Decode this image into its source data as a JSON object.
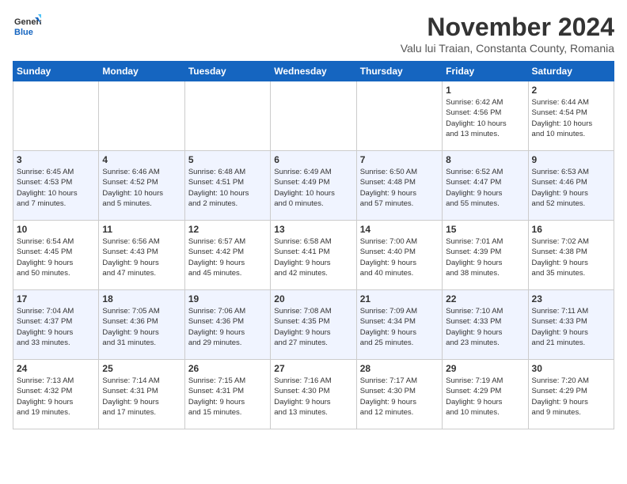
{
  "logo": {
    "line1": "General",
    "line2": "Blue"
  },
  "title": "November 2024",
  "subtitle": "Valu lui Traian, Constanta County, Romania",
  "weekdays": [
    "Sunday",
    "Monday",
    "Tuesday",
    "Wednesday",
    "Thursday",
    "Friday",
    "Saturday"
  ],
  "weeks": [
    [
      {
        "day": "",
        "info": ""
      },
      {
        "day": "",
        "info": ""
      },
      {
        "day": "",
        "info": ""
      },
      {
        "day": "",
        "info": ""
      },
      {
        "day": "",
        "info": ""
      },
      {
        "day": "1",
        "info": "Sunrise: 6:42 AM\nSunset: 4:56 PM\nDaylight: 10 hours\nand 13 minutes."
      },
      {
        "day": "2",
        "info": "Sunrise: 6:44 AM\nSunset: 4:54 PM\nDaylight: 10 hours\nand 10 minutes."
      }
    ],
    [
      {
        "day": "3",
        "info": "Sunrise: 6:45 AM\nSunset: 4:53 PM\nDaylight: 10 hours\nand 7 minutes."
      },
      {
        "day": "4",
        "info": "Sunrise: 6:46 AM\nSunset: 4:52 PM\nDaylight: 10 hours\nand 5 minutes."
      },
      {
        "day": "5",
        "info": "Sunrise: 6:48 AM\nSunset: 4:51 PM\nDaylight: 10 hours\nand 2 minutes."
      },
      {
        "day": "6",
        "info": "Sunrise: 6:49 AM\nSunset: 4:49 PM\nDaylight: 10 hours\nand 0 minutes."
      },
      {
        "day": "7",
        "info": "Sunrise: 6:50 AM\nSunset: 4:48 PM\nDaylight: 9 hours\nand 57 minutes."
      },
      {
        "day": "8",
        "info": "Sunrise: 6:52 AM\nSunset: 4:47 PM\nDaylight: 9 hours\nand 55 minutes."
      },
      {
        "day": "9",
        "info": "Sunrise: 6:53 AM\nSunset: 4:46 PM\nDaylight: 9 hours\nand 52 minutes."
      }
    ],
    [
      {
        "day": "10",
        "info": "Sunrise: 6:54 AM\nSunset: 4:45 PM\nDaylight: 9 hours\nand 50 minutes."
      },
      {
        "day": "11",
        "info": "Sunrise: 6:56 AM\nSunset: 4:43 PM\nDaylight: 9 hours\nand 47 minutes."
      },
      {
        "day": "12",
        "info": "Sunrise: 6:57 AM\nSunset: 4:42 PM\nDaylight: 9 hours\nand 45 minutes."
      },
      {
        "day": "13",
        "info": "Sunrise: 6:58 AM\nSunset: 4:41 PM\nDaylight: 9 hours\nand 42 minutes."
      },
      {
        "day": "14",
        "info": "Sunrise: 7:00 AM\nSunset: 4:40 PM\nDaylight: 9 hours\nand 40 minutes."
      },
      {
        "day": "15",
        "info": "Sunrise: 7:01 AM\nSunset: 4:39 PM\nDaylight: 9 hours\nand 38 minutes."
      },
      {
        "day": "16",
        "info": "Sunrise: 7:02 AM\nSunset: 4:38 PM\nDaylight: 9 hours\nand 35 minutes."
      }
    ],
    [
      {
        "day": "17",
        "info": "Sunrise: 7:04 AM\nSunset: 4:37 PM\nDaylight: 9 hours\nand 33 minutes."
      },
      {
        "day": "18",
        "info": "Sunrise: 7:05 AM\nSunset: 4:36 PM\nDaylight: 9 hours\nand 31 minutes."
      },
      {
        "day": "19",
        "info": "Sunrise: 7:06 AM\nSunset: 4:36 PM\nDaylight: 9 hours\nand 29 minutes."
      },
      {
        "day": "20",
        "info": "Sunrise: 7:08 AM\nSunset: 4:35 PM\nDaylight: 9 hours\nand 27 minutes."
      },
      {
        "day": "21",
        "info": "Sunrise: 7:09 AM\nSunset: 4:34 PM\nDaylight: 9 hours\nand 25 minutes."
      },
      {
        "day": "22",
        "info": "Sunrise: 7:10 AM\nSunset: 4:33 PM\nDaylight: 9 hours\nand 23 minutes."
      },
      {
        "day": "23",
        "info": "Sunrise: 7:11 AM\nSunset: 4:33 PM\nDaylight: 9 hours\nand 21 minutes."
      }
    ],
    [
      {
        "day": "24",
        "info": "Sunrise: 7:13 AM\nSunset: 4:32 PM\nDaylight: 9 hours\nand 19 minutes."
      },
      {
        "day": "25",
        "info": "Sunrise: 7:14 AM\nSunset: 4:31 PM\nDaylight: 9 hours\nand 17 minutes."
      },
      {
        "day": "26",
        "info": "Sunrise: 7:15 AM\nSunset: 4:31 PM\nDaylight: 9 hours\nand 15 minutes."
      },
      {
        "day": "27",
        "info": "Sunrise: 7:16 AM\nSunset: 4:30 PM\nDaylight: 9 hours\nand 13 minutes."
      },
      {
        "day": "28",
        "info": "Sunrise: 7:17 AM\nSunset: 4:30 PM\nDaylight: 9 hours\nand 12 minutes."
      },
      {
        "day": "29",
        "info": "Sunrise: 7:19 AM\nSunset: 4:29 PM\nDaylight: 9 hours\nand 10 minutes."
      },
      {
        "day": "30",
        "info": "Sunrise: 7:20 AM\nSunset: 4:29 PM\nDaylight: 9 hours\nand 9 minutes."
      }
    ]
  ]
}
